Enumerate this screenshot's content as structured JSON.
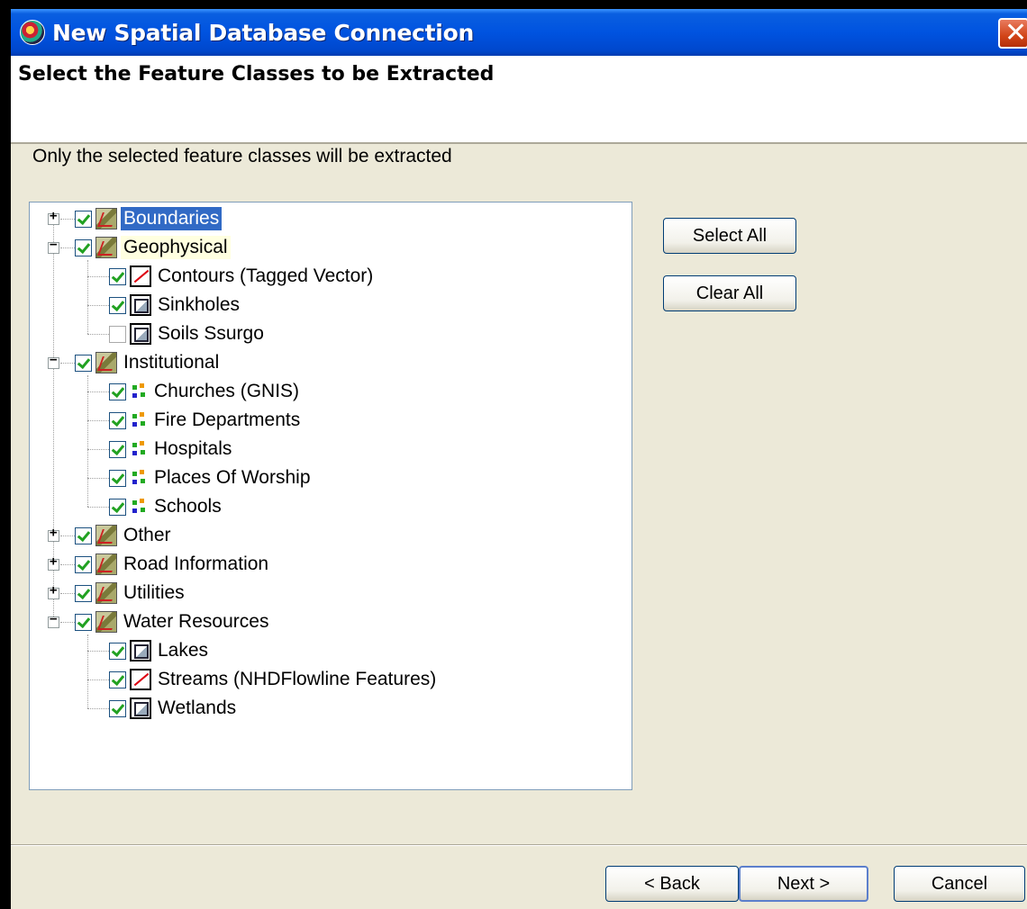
{
  "window": {
    "title": "New Spatial Database Connection",
    "close_glyph": "✕"
  },
  "header": {
    "title": "Select the Feature Classes to be Extracted"
  },
  "instruction": "Only the selected feature classes will be extracted",
  "tree": {
    "items": [
      {
        "label": "Boundaries",
        "checked": true,
        "icon": "layer-group-icon"
      },
      {
        "label": "Geophysical",
        "checked": true,
        "icon": "layer-group-icon"
      },
      {
        "label": "Contours (Tagged Vector)",
        "checked": true,
        "icon": "line-feature-icon"
      },
      {
        "label": "Sinkholes",
        "checked": true,
        "icon": "polygon-feature-icon"
      },
      {
        "label": "Soils Ssurgo",
        "checked": false,
        "icon": "polygon-feature-icon"
      },
      {
        "label": "Institutional",
        "checked": true,
        "icon": "layer-group-icon"
      },
      {
        "label": "Churches (GNIS)",
        "checked": true,
        "icon": "point-feature-icon"
      },
      {
        "label": "Fire Departments",
        "checked": true,
        "icon": "point-feature-icon"
      },
      {
        "label": "Hospitals",
        "checked": true,
        "icon": "point-feature-icon"
      },
      {
        "label": "Places Of Worship",
        "checked": true,
        "icon": "point-feature-icon"
      },
      {
        "label": "Schools",
        "checked": true,
        "icon": "point-feature-icon"
      },
      {
        "label": "Other",
        "checked": true,
        "icon": "layer-group-icon"
      },
      {
        "label": "Road Information",
        "checked": true,
        "icon": "layer-group-icon"
      },
      {
        "label": "Utilities",
        "checked": true,
        "icon": "layer-group-icon"
      },
      {
        "label": "Water Resources",
        "checked": true,
        "icon": "layer-group-icon"
      },
      {
        "label": "Lakes",
        "checked": true,
        "icon": "polygon-feature-icon"
      },
      {
        "label": "Streams (NHDFlowline Features)",
        "checked": true,
        "icon": "line-feature-icon"
      },
      {
        "label": "Wetlands",
        "checked": true,
        "icon": "polygon-feature-icon"
      }
    ],
    "expander_plus": "+",
    "expander_minus": "−"
  },
  "buttons": {
    "select_all": "Select All",
    "clear_all": "Clear All",
    "back": "< Back",
    "next": "Next >",
    "cancel": "Cancel"
  },
  "colors": {
    "title_bar": "#0053e0",
    "selection": "#316ac5",
    "dialog_bg": "#ece9d8",
    "check": "#21a121"
  }
}
